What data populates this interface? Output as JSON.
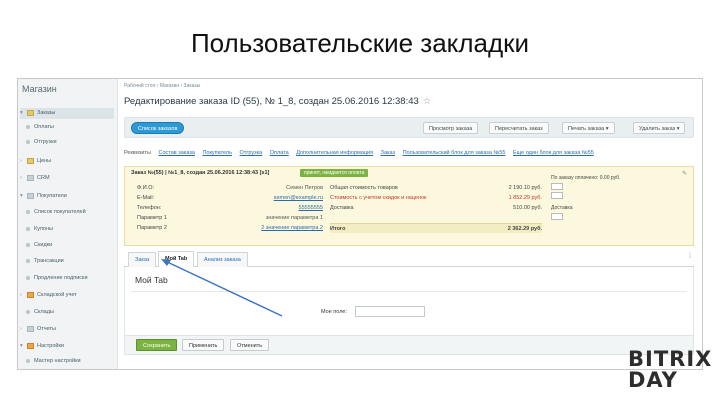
{
  "slide": {
    "title": "Пользовательские закладки",
    "logo_line1": "BITRIX",
    "logo_line2": "DAY"
  },
  "colors": {
    "accent_blue": "#2d9ad6",
    "save_green": "#7cb342",
    "status_green": "#7cb342",
    "logo_red": "#e2233d",
    "arrow_blue": "#3b74c4"
  },
  "sidebar": {
    "title": "Магазин",
    "items": [
      {
        "label": "Заказы",
        "icon": "folder-icon",
        "expanded": true
      },
      {
        "label": "Оплаты",
        "icon": "bullet"
      },
      {
        "label": "Отгрузки",
        "icon": "bullet"
      },
      {
        "label": "Цены",
        "icon": "folder-icon"
      },
      {
        "label": "CRM",
        "icon": "funnel-icon"
      },
      {
        "label": "Покупатели",
        "icon": "users-icon"
      },
      {
        "label": "Список покупателей",
        "icon": "bullet"
      },
      {
        "label": "Купоны",
        "icon": "bullet"
      },
      {
        "label": "Скидки",
        "icon": "bullet"
      },
      {
        "label": "Трансакции",
        "icon": "bullet"
      },
      {
        "label": "Продление подписки",
        "icon": "bullet"
      },
      {
        "label": "Складской учет",
        "icon": "warehouse-icon"
      },
      {
        "label": "Склады",
        "icon": "bullet"
      },
      {
        "label": "Отчеты",
        "icon": "report-icon"
      },
      {
        "label": "Настройки",
        "icon": "settings-icon"
      },
      {
        "label": "Мастер настройки",
        "icon": "bullet"
      }
    ]
  },
  "header": {
    "breadcrumbs": "Рабочий стол  ›  Магазин  ›  Заказы",
    "title": "Редактирование заказа ID (55), № 1_8, создан 25.06.2016 12:38:43"
  },
  "toolbar": {
    "back_label": "Список заказов",
    "view_label": "Просмотр заказа",
    "recalc_label": "Пересчитать заказ",
    "print_label": "Печать заказа",
    "delete_label": "Удалить заказ"
  },
  "section_links": [
    "Реквизиты",
    "Состав заказа",
    "Покупатель",
    "Отгрузка",
    "Оплата",
    "Дополнительная информация",
    "Заказ",
    "Пользовательский блок для заказа №55",
    "Еще один блок для заказа №55"
  ],
  "order": {
    "header": "Заказ №(55) | №1_8, создан 25.06.2016 12:38:43 [s1]",
    "status": "принят, ожидается оплата",
    "fields": [
      {
        "label": "Ф.И.О:",
        "value": "Семен Петров",
        "link": false
      },
      {
        "label": "E-Mail:",
        "value": "semen@example.ru",
        "link": true
      },
      {
        "label": "Телефон:",
        "value": "55555555",
        "link": true
      },
      {
        "label": "Параметр 1",
        "value": "значение параметра 1",
        "link": false
      },
      {
        "label": "Параметр 2",
        "value": "2 значение параметра 2",
        "link": true
      }
    ],
    "totals": [
      {
        "label": "Общая стоимость товаров",
        "value": "2 190.10 руб.",
        "red": false
      },
      {
        "label": "Стоимость с учетом скидок и наценок",
        "value": "1 852.29 руб.",
        "red": true
      },
      {
        "label": "Доставка",
        "value": "510.00 руб.",
        "red": false
      },
      {
        "label": "",
        "value": "",
        "red": false
      },
      {
        "label": "Итого",
        "value": "2 362.29 руб.",
        "red": false,
        "total": true
      }
    ],
    "payment_note": "По заказу оплачено: 0.00 руб.",
    "delivery_note": "Доставка"
  },
  "tabs": [
    {
      "label": "Заказ",
      "active": false
    },
    {
      "label": "Мой Tab",
      "active": true
    },
    {
      "label": "Анализ заказа",
      "active": false
    }
  ],
  "content": {
    "title": "Мой Tab",
    "field_label": "Мое поле:",
    "field_value": ""
  },
  "footer": {
    "save_label": "Сохранить",
    "apply_label": "Применить",
    "cancel_label": "Отменить"
  }
}
